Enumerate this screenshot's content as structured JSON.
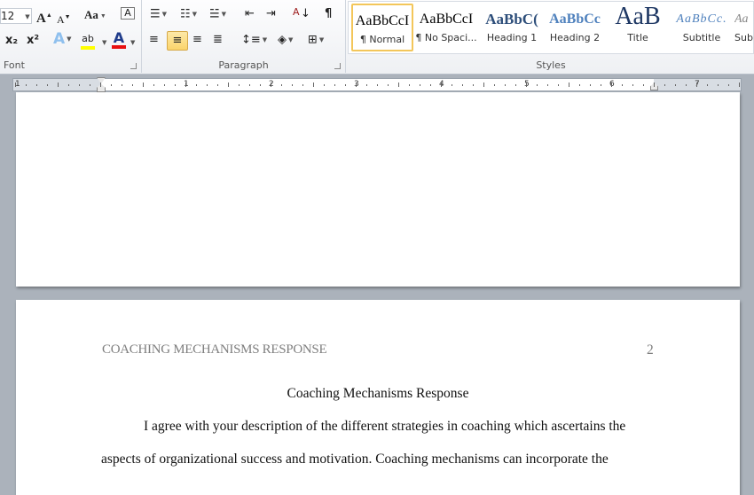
{
  "ribbon": {
    "font": {
      "label": "Font",
      "size": "12",
      "grow_icon": "grow-font-icon",
      "shrink_icon": "shrink-font-icon",
      "change_case": "Aa",
      "subscript": "x₂",
      "superscript": "x²",
      "highlight_color": "#ffff00",
      "font_color": "#e81010"
    },
    "paragraph": {
      "label": "Paragraph",
      "alignment": "center"
    },
    "styles": {
      "label": "Styles",
      "items": [
        {
          "preview": "AaBbCcI",
          "name": "¶ Normal",
          "selected": true
        },
        {
          "preview": "AaBbCcI",
          "name": "¶ No Spaci..."
        },
        {
          "preview": "AaBbC(",
          "name": "Heading 1"
        },
        {
          "preview": "AaBbCc",
          "name": "Heading 2"
        },
        {
          "preview": "AaB",
          "name": "Title"
        },
        {
          "preview": "AaBbCc.",
          "name": "Subtitle"
        },
        {
          "preview": "Aa",
          "name": "Sub"
        }
      ]
    }
  },
  "ruler": {
    "numbers": [
      "1",
      "1",
      "2",
      "3",
      "4",
      "5",
      "6",
      "7"
    ]
  },
  "document": {
    "header": "COACHING MECHANISMS RESPONSE",
    "page_number": "2",
    "title": "Coaching Mechanisms Response",
    "lines": [
      "I agree with your description of the different strategies in coaching which ascertains the",
      "aspects of organizational success and motivation. Coaching mechanisms can incorporate the"
    ]
  }
}
